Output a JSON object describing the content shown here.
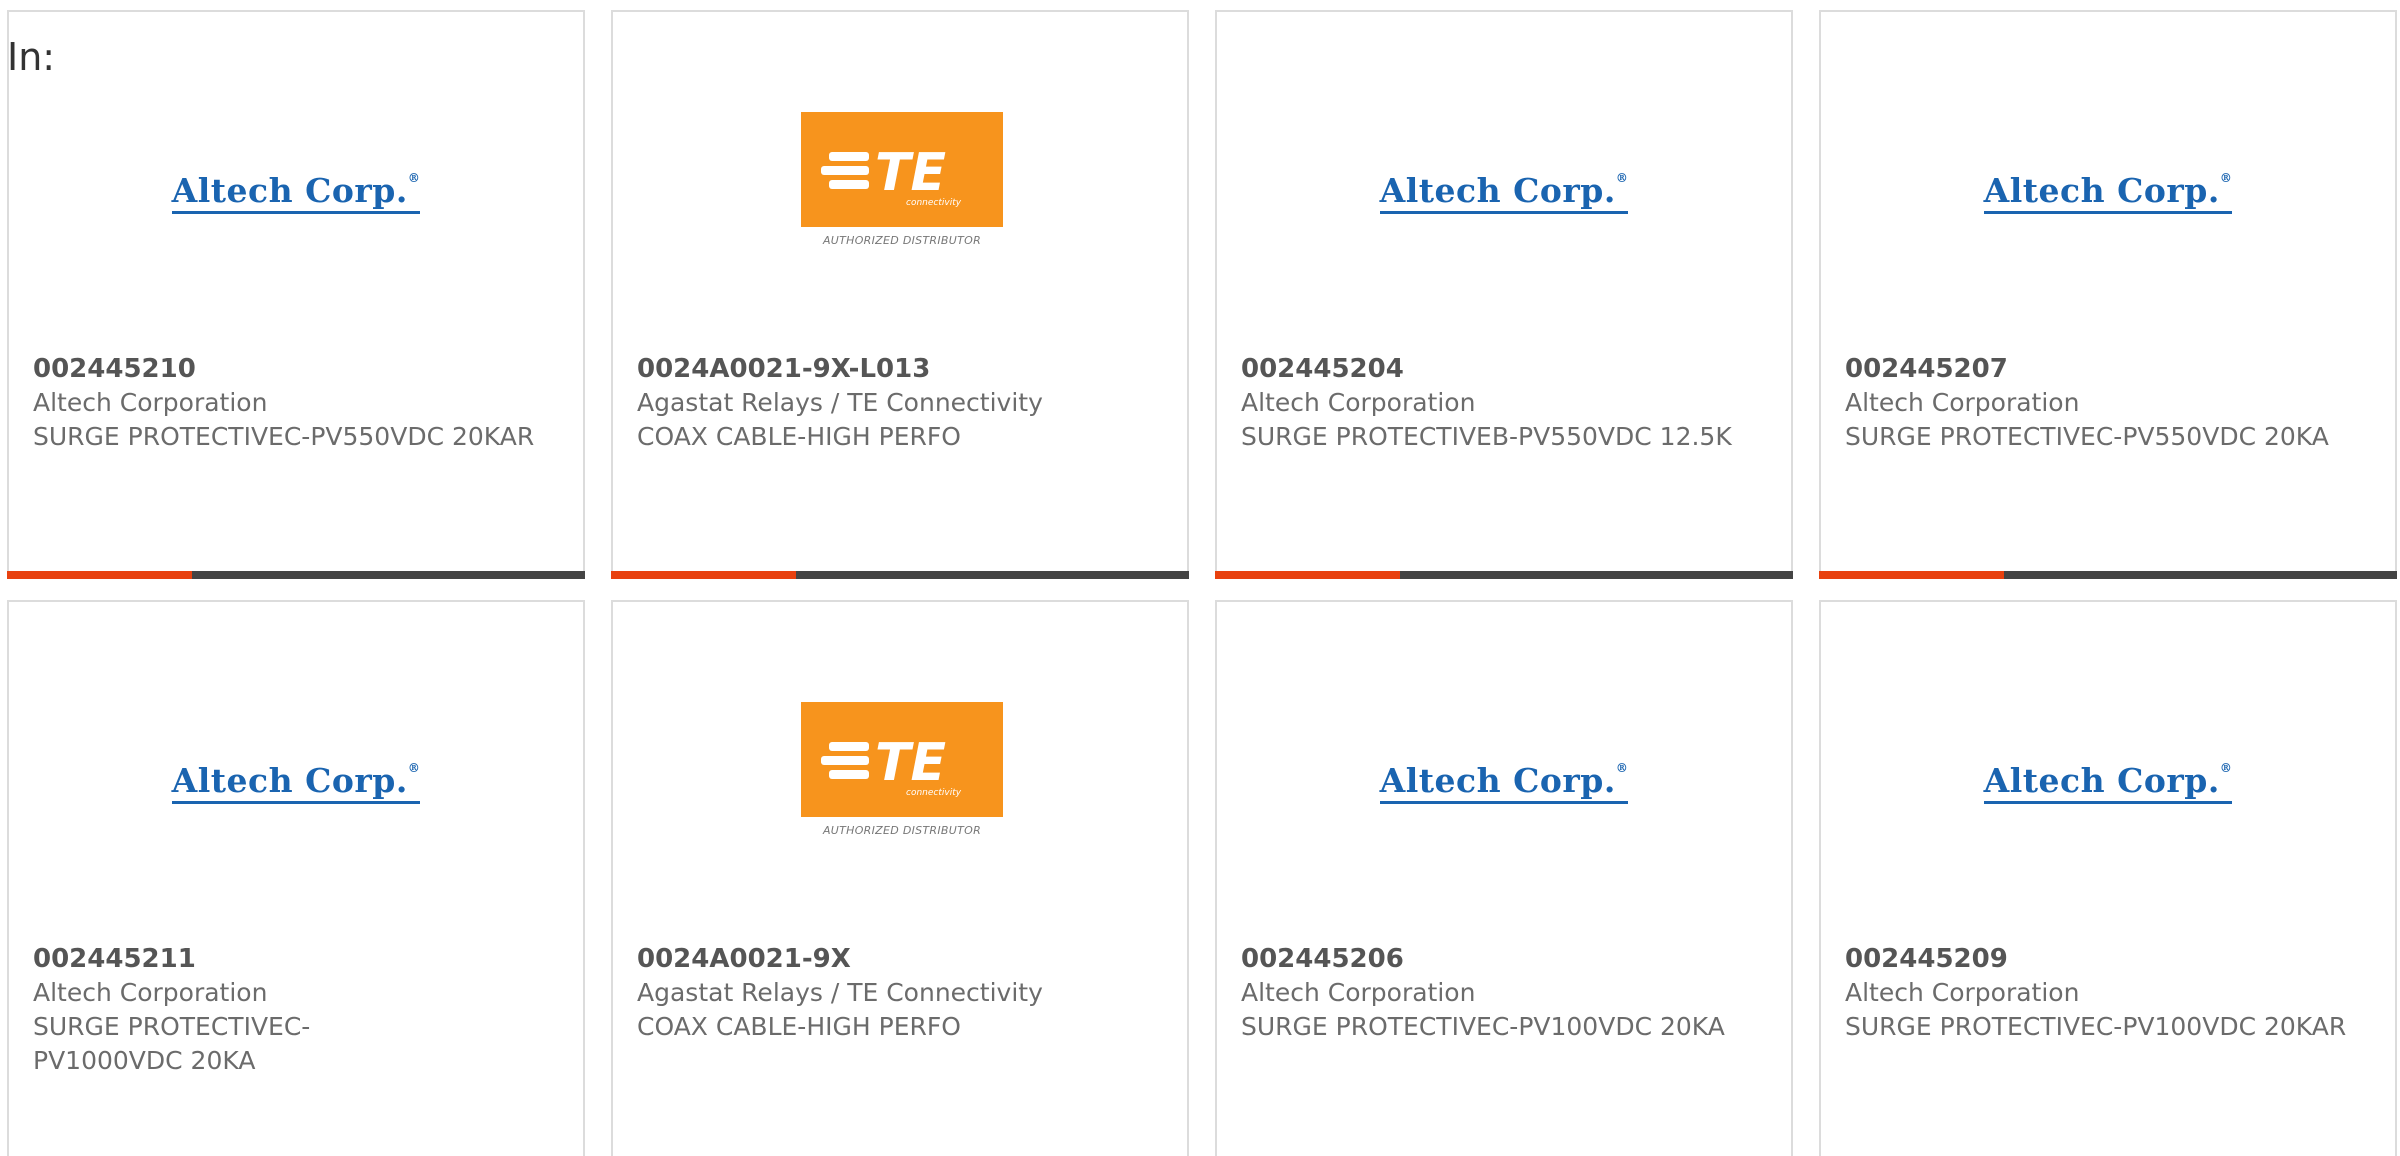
{
  "header": {
    "label": "In:"
  },
  "colors": {
    "accent": "#e8410f",
    "bar": "#444444",
    "altech_blue": "#1a64b0",
    "te_orange": "#f7941d"
  },
  "logos": {
    "altech": {
      "text": "Altech Corp.",
      "mark": "®"
    },
    "te": {
      "text": "TE",
      "sub": "connectivity",
      "caption": "AUTHORIZED DISTRIBUTOR"
    }
  },
  "products": [
    {
      "part": "002445210",
      "manufacturer": "Altech Corporation",
      "description": "SURGE PROTECTIVEC-PV550VDC 20KAR",
      "logo": "altech",
      "progress_fraction": 0.32
    },
    {
      "part": "0024A0021-9X-L013",
      "manufacturer": "Agastat Relays / TE Connectivity",
      "description": "COAX CABLE-HIGH PERFO",
      "logo": "te",
      "progress_fraction": 0.32
    },
    {
      "part": "002445204",
      "manufacturer": "Altech Corporation",
      "description": "SURGE PROTECTIVEB-PV550VDC 12.5K",
      "logo": "altech",
      "progress_fraction": 0.32
    },
    {
      "part": "002445207",
      "manufacturer": "Altech Corporation",
      "description": "SURGE PROTECTIVEC-PV550VDC 20KA",
      "logo": "altech",
      "progress_fraction": 0.32
    },
    {
      "part": "002445211",
      "manufacturer": "Altech Corporation",
      "description": "SURGE PROTECTIVEC-PV1000VDC 20KA",
      "logo": "altech"
    },
    {
      "part": "0024A0021-9X",
      "manufacturer": "Agastat Relays / TE Connectivity",
      "description": "COAX CABLE-HIGH PERFO",
      "logo": "te"
    },
    {
      "part": "002445206",
      "manufacturer": "Altech Corporation",
      "description": "SURGE PROTECTIVEC-PV100VDC 20KA",
      "logo": "altech"
    },
    {
      "part": "002445209",
      "manufacturer": "Altech Corporation",
      "description": "SURGE PROTECTIVEC-PV100VDC 20KAR",
      "logo": "altech"
    }
  ]
}
